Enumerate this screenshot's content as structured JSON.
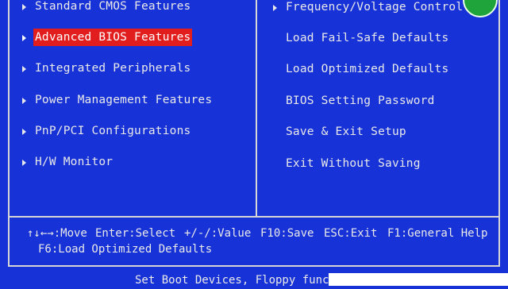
{
  "menu": {
    "left": [
      {
        "label": "Standard CMOS Features",
        "selected": false
      },
      {
        "label": "Advanced BIOS Features",
        "selected": true
      },
      {
        "label": "Integrated Peripherals",
        "selected": false
      },
      {
        "label": "Power Management Features",
        "selected": false
      },
      {
        "label": "PnP/PCI Configurations",
        "selected": false
      },
      {
        "label": "H/W Monitor",
        "selected": false
      }
    ],
    "right": [
      {
        "label": "Frequency/Voltage Control",
        "has_arrow": true
      },
      {
        "label": "Load Fail-Safe Defaults",
        "has_arrow": false
      },
      {
        "label": "Load Optimized Defaults",
        "has_arrow": false
      },
      {
        "label": "BIOS Setting Password",
        "has_arrow": false
      },
      {
        "label": "Save & Exit Setup",
        "has_arrow": false
      },
      {
        "label": "Exit Without Saving",
        "has_arrow": false
      }
    ]
  },
  "help": {
    "row1": [
      {
        "name": "move",
        "text": "↑↓←→:Move"
      },
      {
        "name": "select",
        "text": "Enter:Select"
      },
      {
        "name": "value",
        "text": "+/-/:Value"
      },
      {
        "name": "save",
        "text": "F10:Save"
      },
      {
        "name": "exit",
        "text": "ESC:Exit"
      },
      {
        "name": "general-help",
        "text": "F1:General Help"
      }
    ],
    "row2": "F6:Load Optimized Defaults"
  },
  "status": {
    "text": "Set Boot Devices, Floppy functi"
  },
  "colors": {
    "background": "#1732d6",
    "selection": "#e21d1d",
    "text": "#e9e9e9",
    "badge": "#1ea43a"
  }
}
